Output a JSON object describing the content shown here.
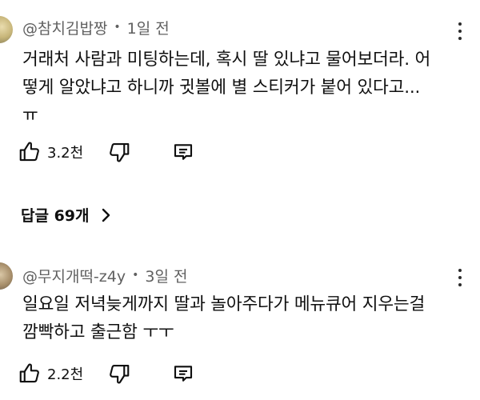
{
  "comments": [
    {
      "author": "@참치김밥짱",
      "time": "1일 전",
      "lines": [
        "거래처 사람과 미팅하는데, 혹시 딸 있냐고 물어보더라. 어",
        "떻게 알았냐고 하니까 귓볼에 별 스티커가 붙어 있다고...",
        "ㅠ"
      ],
      "likes": "3.2천",
      "replies_label": "답글 69개"
    },
    {
      "author": "@무지개떡-z4y",
      "time": "3일 전",
      "lines": [
        "일요일 저녁늦게까지 딸과 놀아주다가 메뉴큐어 지우는걸",
        "깜빡하고 출근함 ㅜㅜ"
      ],
      "likes": "2.2천"
    }
  ],
  "separator": "•",
  "icons": {
    "like": "thumbs-up-icon",
    "dislike": "thumbs-down-icon",
    "reply": "reply-comment-icon",
    "more": "vertical-ellipsis-icon",
    "chevron": "chevron-right-icon"
  }
}
